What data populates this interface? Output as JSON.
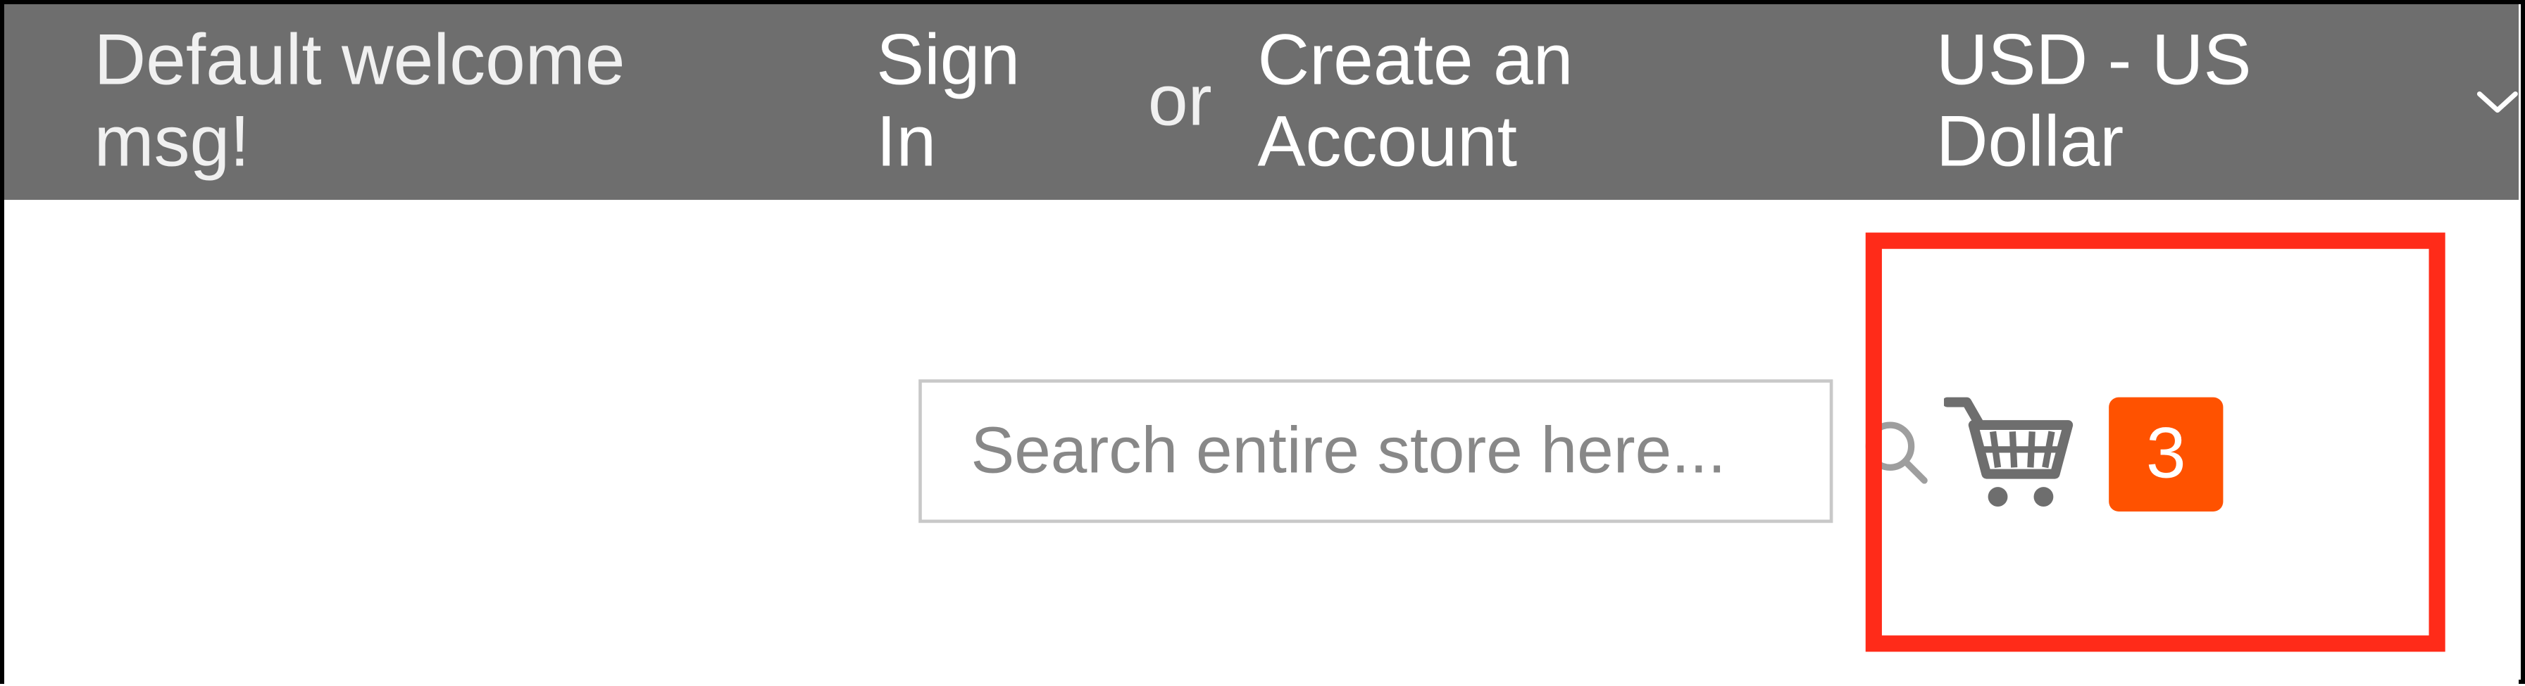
{
  "header": {
    "welcome": "Default welcome msg!",
    "sign_in": "Sign In",
    "or": "or",
    "create_account": "Create an Account",
    "currency": "USD - US Dollar"
  },
  "search": {
    "placeholder": "Search entire store here..."
  },
  "cart": {
    "count": "3"
  },
  "colors": {
    "accent": "#ff5200",
    "callout": "#ff2b19",
    "header_bg": "#6e6e6e"
  }
}
